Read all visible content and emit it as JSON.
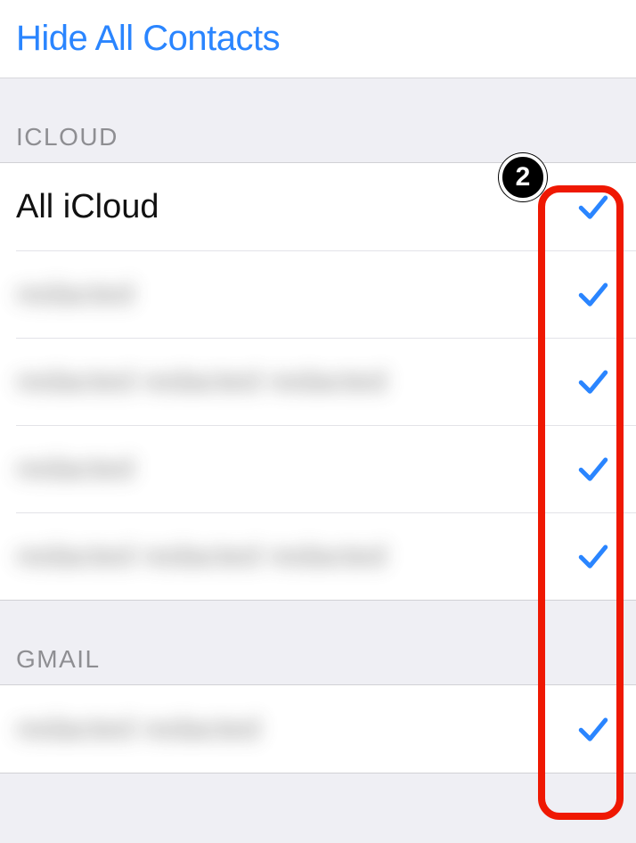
{
  "topbar": {
    "hide_all_label": "Hide All Contacts"
  },
  "sections": [
    {
      "header": "ICLOUD",
      "items": [
        {
          "label": "All iCloud",
          "checked": true,
          "blurred": false
        },
        {
          "label": "redacted",
          "checked": true,
          "blurred": true
        },
        {
          "label": "redacted redacted redacted",
          "checked": true,
          "blurred": true
        },
        {
          "label": "redacted",
          "checked": true,
          "blurred": true
        },
        {
          "label": "redacted redacted redacted",
          "checked": true,
          "blurred": true
        }
      ]
    },
    {
      "header": "GMAIL",
      "items": [
        {
          "label": "redacted redacted",
          "checked": true,
          "blurred": true
        }
      ]
    }
  ],
  "annotation": {
    "badge": "2"
  }
}
